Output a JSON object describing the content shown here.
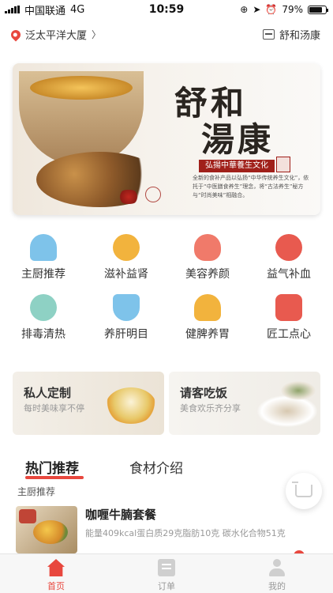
{
  "status_bar": {
    "carrier": "中国联通",
    "network": "4G",
    "time": "10:59",
    "battery_percent": "79%",
    "battery_level": 0.79
  },
  "header": {
    "location": "泛太平洋大厦",
    "store_name": "舒和汤康"
  },
  "banner": {
    "brand_line1": "舒和",
    "brand_line2": "湯康",
    "slogan": "弘揚中華養生文化",
    "blurb": "全新的食补产品以弘扬“中华传统养生文化”，依托于“中医膳食养生”理念，将“古法养生”秘方与“时尚美味”相融合。"
  },
  "categories": [
    {
      "label": "主厨推荐",
      "icon": "chef-hat-icon",
      "color": "#7ec3ea"
    },
    {
      "label": "滋补益肾",
      "icon": "soup-bowl-icon",
      "color": "#f2b33d"
    },
    {
      "label": "美容养颜",
      "icon": "woman-face-icon",
      "color": "#f07a6a"
    },
    {
      "label": "益气补血",
      "icon": "blood-bowl-icon",
      "color": "#e85a4f"
    },
    {
      "label": "排毒清热",
      "icon": "tea-bowl-icon",
      "color": "#8ed1c4"
    },
    {
      "label": "养肝明目",
      "icon": "tea-cup-icon",
      "color": "#7ec3ea"
    },
    {
      "label": "健脾养胃",
      "icon": "meditation-icon",
      "color": "#f2b33d"
    },
    {
      "label": "匠工点心",
      "icon": "dessert-icon",
      "color": "#e85a4f"
    }
  ],
  "promos": [
    {
      "title": "私人定制",
      "subtitle": "每时美味享不停"
    },
    {
      "title": "请客吃饭",
      "subtitle": "美食欢乐齐分享"
    }
  ],
  "tabs": [
    {
      "label": "热门推荐",
      "active": true
    },
    {
      "label": "食材介绍",
      "active": false
    }
  ],
  "section_label": "主厨推荐",
  "food_item": {
    "name": "咖喱牛腩套餐",
    "info": "能量409kcal蛋白质29克脂肪10克 碳水化合物51克"
  },
  "bottom_nav": [
    {
      "label": "首页",
      "icon": "home-icon",
      "active": true
    },
    {
      "label": "订单",
      "icon": "order-icon",
      "active": false
    },
    {
      "label": "我的",
      "icon": "profile-icon",
      "active": false
    }
  ],
  "colors": {
    "accent": "#e8473e",
    "text_primary": "#333333",
    "text_secondary": "#999999"
  }
}
